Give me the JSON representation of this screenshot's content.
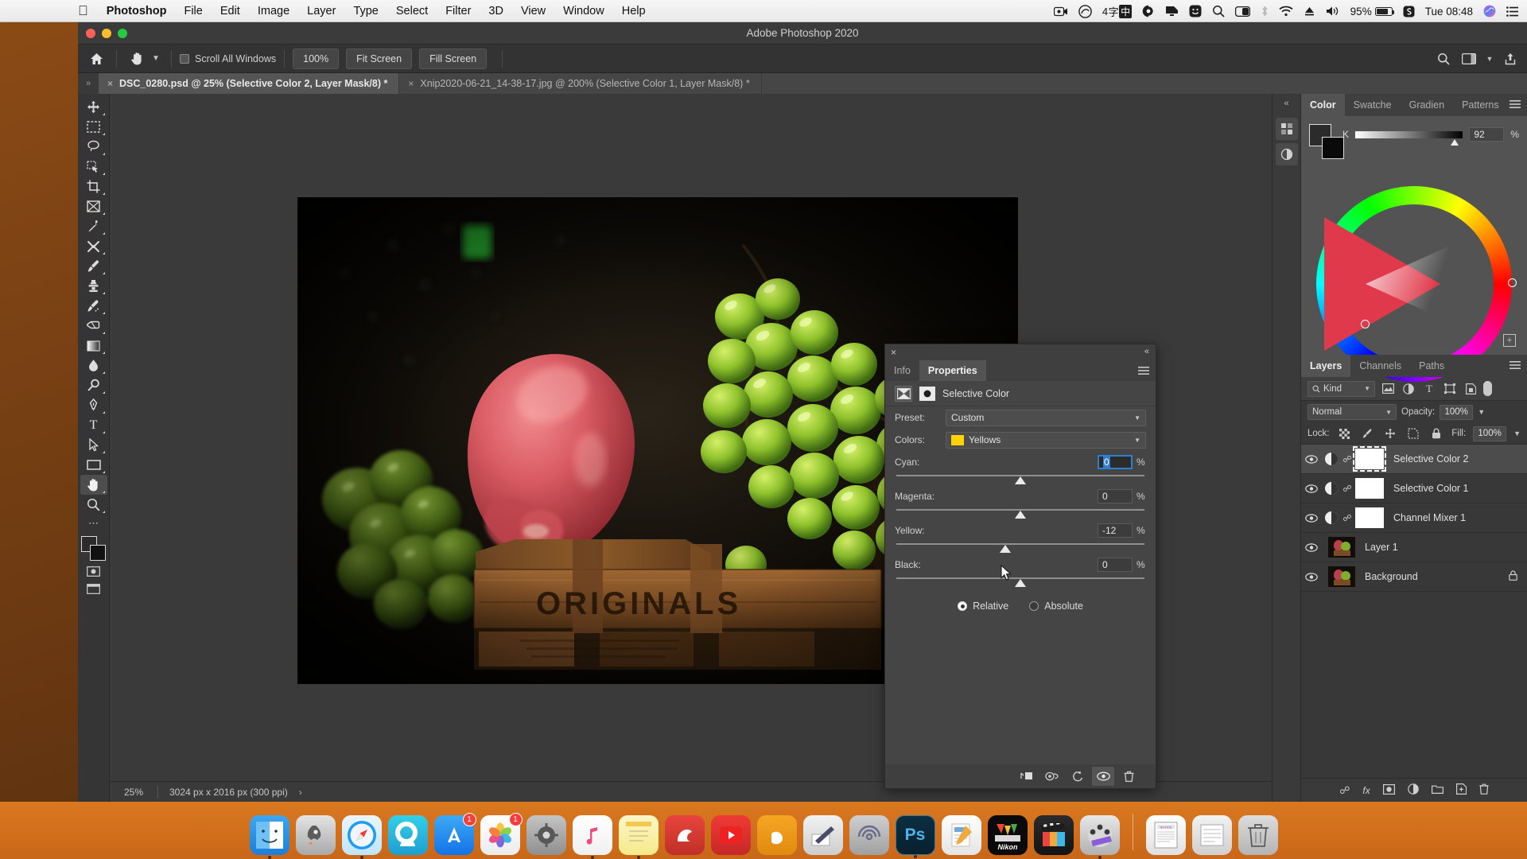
{
  "menubar": {
    "apple": "apple-logo",
    "items": [
      {
        "label": "Photoshop",
        "bold": true
      },
      {
        "label": "File"
      },
      {
        "label": "Edit"
      },
      {
        "label": "Image"
      },
      {
        "label": "Layer"
      },
      {
        "label": "Type"
      },
      {
        "label": "Select"
      },
      {
        "label": "Filter"
      },
      {
        "label": "3D"
      },
      {
        "label": "View"
      },
      {
        "label": "Window"
      },
      {
        "label": "Help"
      }
    ],
    "status": {
      "screen_record_icon": "screen-record-icon",
      "creative_cloud_icon": "creative-cloud-icon",
      "ime_count": "4",
      "ime_char": "字",
      "ime_mode": "中",
      "app_icon": "cleaner-icon",
      "display_icon": "display-icon",
      "emoji_icon": "emoji-icon",
      "search_icon": "spotlight-icon",
      "control_center_icon": "control-center-icon",
      "bluetooth_icon": "bluetooth-icon",
      "wifi_icon": "wifi-icon",
      "eject_icon": "eject-icon",
      "volume_icon": "volume-icon",
      "battery_percent": "95%",
      "battery_charging_icon": "battery-charging-icon",
      "snipaste_icon": "snipaste-icon",
      "clock": "Tue 08:48",
      "siri_icon": "siri-icon",
      "notification_icon": "notification-center-icon"
    }
  },
  "window": {
    "title": "Adobe Photoshop 2020",
    "traffic": {
      "close": "close-button",
      "minimize": "minimize-button",
      "zoom": "zoom-button"
    }
  },
  "options_bar": {
    "home_icon": "home-icon",
    "tool_icon": "hand-tool-icon",
    "tool_chevron": "chevron-down-icon",
    "scroll_all_windows": "Scroll All Windows",
    "scroll_all_checked": false,
    "zoom_100": "100%",
    "fit_screen": "Fit Screen",
    "fill_screen": "Fill Screen",
    "search_icon": "search-icon",
    "workspace_icon": "workspace-icon",
    "share_icon": "share-icon"
  },
  "tabs": {
    "grip_icon": "panel-expand-icon",
    "items": [
      {
        "label": "DSC_0280.psd @ 25% (Selective Color 2, Layer Mask/8) *",
        "active": true,
        "close": "×"
      },
      {
        "label": "Xnip2020-06-21_14-38-17.jpg @ 200% (Selective Color 1, Layer Mask/8) *",
        "active": false,
        "close": "×"
      }
    ]
  },
  "toolbar": {
    "tools": [
      {
        "name": "move-tool",
        "glyph": "✥"
      },
      {
        "name": "rectangular-marquee-tool",
        "glyph": "⬚"
      },
      {
        "name": "lasso-tool",
        "glyph": "◯"
      },
      {
        "name": "quick-selection-tool",
        "glyph": "▨"
      },
      {
        "name": "crop-tool",
        "glyph": "⌙"
      },
      {
        "name": "frame-tool",
        "glyph": "⌧"
      },
      {
        "name": "eyedropper-tool",
        "glyph": "✒"
      },
      {
        "name": "spot-healing-brush-tool",
        "glyph": "✗"
      },
      {
        "name": "brush-tool",
        "glyph": "✎"
      },
      {
        "name": "clone-stamp-tool",
        "glyph": "⚑"
      },
      {
        "name": "history-brush-tool",
        "glyph": "✐"
      },
      {
        "name": "eraser-tool",
        "glyph": "▱"
      },
      {
        "name": "gradient-tool",
        "glyph": "▤"
      },
      {
        "name": "blur-tool",
        "glyph": "●"
      },
      {
        "name": "dodge-tool",
        "glyph": "⚲"
      },
      {
        "name": "pen-tool",
        "glyph": "✑"
      },
      {
        "name": "horizontal-type-tool",
        "glyph": "T"
      },
      {
        "name": "path-selection-tool",
        "glyph": "➤"
      },
      {
        "name": "rectangle-tool",
        "glyph": "▭"
      },
      {
        "name": "hand-tool",
        "glyph": "✋",
        "active": true
      },
      {
        "name": "zoom-tool",
        "glyph": "⌕"
      }
    ],
    "more_icon": "more-tools-icon",
    "foreground_color": "#2b2b2b",
    "background_color": "#111111",
    "quick_mask_icon": "quick-mask-icon",
    "screen_mode_icon": "screen-mode-icon"
  },
  "canvas": {
    "image_alt": "still-life-apple-grapes-crate",
    "crate_text": "ORIGINALS"
  },
  "status_bar": {
    "zoom": "25%",
    "dimensions": "3024 px x 2016 px (300 ppi)",
    "arrow": "›"
  },
  "color_panel": {
    "tabs": [
      {
        "label": "Color",
        "active": true
      },
      {
        "label": "Swatche",
        "active": false
      },
      {
        "label": "Gradien",
        "active": false
      },
      {
        "label": "Patterns",
        "active": false
      }
    ],
    "menu_icon": "panel-menu-icon",
    "k_label": "K",
    "k_value": "92",
    "k_percent": "%",
    "add_swatch_icon": "add-swatch-icon",
    "foreground": "#2b2b2b",
    "background": "#0a0a0a"
  },
  "properties_panel": {
    "close_icon": "×",
    "collapse_icon": "«",
    "tabs": [
      {
        "label": "Info",
        "active": false
      },
      {
        "label": "Properties",
        "active": true
      }
    ],
    "menu_icon": "panel-menu-icon",
    "adjustment_icon": "selective-color-icon",
    "mask_icon": "layer-mask-icon",
    "title": "Selective Color",
    "preset_label": "Preset:",
    "preset_value": "Custom",
    "colors_label": "Colors:",
    "colors_value": "Yellows",
    "colors_swatch": "#ffd400",
    "sliders": [
      {
        "name": "Cyan:",
        "value": "0",
        "percent": "%",
        "thumb_pct": 50,
        "focused": true
      },
      {
        "name": "Magenta:",
        "value": "0",
        "percent": "%",
        "thumb_pct": 50,
        "focused": false
      },
      {
        "name": "Yellow:",
        "value": "-12",
        "percent": "%",
        "thumb_pct": 44,
        "focused": false
      },
      {
        "name": "Black:",
        "value": "0",
        "percent": "%",
        "thumb_pct": 50,
        "focused": false
      }
    ],
    "method_relative": "Relative",
    "method_absolute": "Absolute",
    "method_selected": "Relative",
    "footer": {
      "clip_icon": "clip-to-layer-icon",
      "preview_icon": "toggle-visibility-icon",
      "reset_icon": "reset-icon",
      "eye_icon": "preview-eye-icon",
      "delete_icon": "delete-adjustment-icon"
    }
  },
  "layers_panel": {
    "tabs": [
      {
        "label": "Layers",
        "active": true
      },
      {
        "label": "Channels",
        "active": false
      },
      {
        "label": "Paths",
        "active": false
      }
    ],
    "menu_icon": "panel-menu-icon",
    "filter_label": "Kind",
    "filter_search_icon": "search-icon",
    "filter_icons": [
      "pixel-filter-icon",
      "adjustment-filter-icon",
      "type-filter-icon",
      "shape-filter-icon",
      "smart-object-filter-icon"
    ],
    "filter_toggle": "filter-toggle",
    "blend_mode": "Normal",
    "opacity_label": "Opacity:",
    "opacity_value": "100%",
    "lock_label": "Lock:",
    "lock_icons": [
      "lock-transparency-icon",
      "lock-image-icon",
      "lock-position-icon",
      "lock-artboard-icon",
      "lock-all-icon"
    ],
    "fill_label": "Fill:",
    "fill_value": "100%",
    "layers": [
      {
        "name": "Selective Color 2",
        "type": "adjustment",
        "selected": true,
        "visible": true,
        "linked": true,
        "mask_selected": true,
        "locked": false
      },
      {
        "name": "Selective Color 1",
        "type": "adjustment",
        "selected": false,
        "visible": true,
        "linked": true,
        "mask_selected": false,
        "locked": false
      },
      {
        "name": "Channel Mixer 1",
        "type": "adjustment",
        "selected": false,
        "visible": true,
        "linked": true,
        "mask_selected": false,
        "locked": false
      },
      {
        "name": "Layer 1",
        "type": "pixel",
        "selected": false,
        "visible": true,
        "linked": false,
        "mask_selected": false,
        "locked": false
      },
      {
        "name": "Background",
        "type": "pixel",
        "selected": false,
        "visible": true,
        "linked": false,
        "mask_selected": false,
        "locked": true
      }
    ],
    "footer_icons": [
      "link-layers-icon",
      "layer-style-icon",
      "add-mask-icon",
      "new-adjustment-icon",
      "new-group-icon",
      "new-layer-icon",
      "delete-layer-icon"
    ]
  },
  "right_dock": {
    "collapse_icon": "«",
    "buttons": [
      "libraries-icon",
      "adjustments-icon"
    ]
  },
  "dock": {
    "apps": [
      {
        "name": "finder",
        "glyph": "◑",
        "bg": "linear-gradient(180deg,#3ea7f0,#1e7ed8)",
        "running": true
      },
      {
        "name": "launchpad",
        "glyph": "🚀",
        "bg": "linear-gradient(180deg,#d8d8d8,#a9a9a9)",
        "running": false
      },
      {
        "name": "safari",
        "glyph": "✵",
        "bg": "linear-gradient(180deg,#e8f4ff,#1f9bf0)",
        "running": true
      },
      {
        "name": "cloud-app",
        "glyph": "◔",
        "bg": "linear-gradient(180deg,#2fd2e8,#1fa5d6)",
        "running": false
      },
      {
        "name": "app-store",
        "glyph": "A",
        "bg": "linear-gradient(180deg,#3fa9f5,#1272e8)",
        "badge": "1",
        "running": false
      },
      {
        "name": "photos",
        "glyph": "❀",
        "bg": "linear-gradient(180deg,#fdfdfd,#eaeaea)",
        "badge": "1",
        "running": false
      },
      {
        "name": "system-preferences",
        "glyph": "⚙",
        "bg": "linear-gradient(180deg,#b9b9b9,#8d8d8d)",
        "running": false
      },
      {
        "name": "music",
        "glyph": "♫",
        "bg": "linear-gradient(180deg,#ffffff,#f2f2f2)",
        "running": true
      },
      {
        "name": "notes",
        "glyph": "☰",
        "bg": "linear-gradient(180deg,#fdf3c0,#f7e98e)",
        "running": true
      },
      {
        "name": "bear",
        "glyph": "◗",
        "bg": "linear-gradient(180deg,#e8453c,#c0392b)",
        "running": false
      },
      {
        "name": "youtube",
        "glyph": "▶",
        "bg": "linear-gradient(180deg,#ef3b34,#c62828)",
        "running": false
      },
      {
        "name": "bartender",
        "glyph": "b",
        "bg": "linear-gradient(180deg,#ffd54a,#f5a623)",
        "running": false
      },
      {
        "name": "sketch-note",
        "glyph": "✎",
        "bg": "linear-gradient(180deg,#f0f0f0,#cfcfcf)",
        "running": false
      },
      {
        "name": "airdrop",
        "glyph": "◎",
        "bg": "linear-gradient(180deg,#c9c9c9,#9e9e9e)",
        "running": false
      },
      {
        "name": "photoshop",
        "glyph": "Ps",
        "bg": "linear-gradient(180deg,#0b2b3d,#071e2b)",
        "running": true
      },
      {
        "name": "pages",
        "glyph": "✍",
        "bg": "linear-gradient(180deg,#ffffff,#e6e6e6)",
        "running": false
      },
      {
        "name": "nikon",
        "glyph": "Nikon",
        "bg": "linear-gradient(180deg,#1a1a1a,#000000)",
        "running": false
      },
      {
        "name": "final-cut-pro",
        "glyph": "🎬",
        "bg": "linear-gradient(180deg,#2b2b2b,#141414)",
        "running": false
      },
      {
        "name": "video-player",
        "glyph": "◉",
        "bg": "linear-gradient(180deg,#e3e3e3,#b5b5b5)",
        "running": true
      }
    ],
    "separator": "dock-separator",
    "stacks": [
      {
        "name": "documents-stack",
        "glyph": "☰"
      },
      {
        "name": "downloads-stack",
        "glyph": "▤"
      },
      {
        "name": "trash",
        "glyph": "🗑"
      }
    ]
  }
}
